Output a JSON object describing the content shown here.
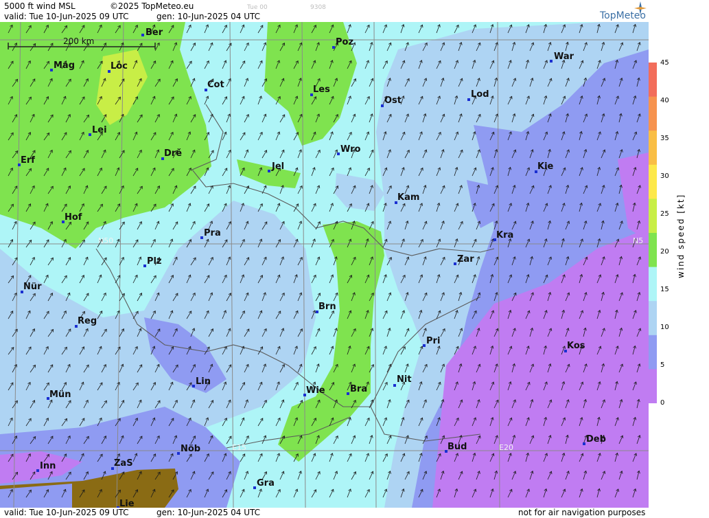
{
  "header": {
    "title": "5000 ft wind MSL",
    "copyright": "©2025 TopMeteo.eu",
    "valid": "valid:  Tue  10-Jun-2025  09 UTC",
    "gen": "gen: 10-Jun-2025 04 UTC",
    "faint_day": "Tue 00",
    "faint_code": "9308",
    "logo_text": "TopMeteo"
  },
  "footer": {
    "valid": "valid:  Tue  10-Jun-2025  09 UTC",
    "gen": "gen: 10-Jun-2025 04 UTC",
    "disclaimer": "not for air navigation purposes"
  },
  "map": {
    "scale_label": "200 km",
    "grid_labels": [
      "N50",
      "N5",
      "E15",
      "E20"
    ],
    "cities": [
      {
        "name": "Ber"
      },
      {
        "name": "Poz"
      },
      {
        "name": "War"
      },
      {
        "name": "Mag"
      },
      {
        "name": "Loc"
      },
      {
        "name": "Cot"
      },
      {
        "name": "Les"
      },
      {
        "name": "Ost"
      },
      {
        "name": "Lod"
      },
      {
        "name": "Lei"
      },
      {
        "name": "Erf"
      },
      {
        "name": "Drě"
      },
      {
        "name": "Jel"
      },
      {
        "name": "Wro"
      },
      {
        "name": "Kie"
      },
      {
        "name": "Kam"
      },
      {
        "name": "Hof"
      },
      {
        "name": "Pra"
      },
      {
        "name": "Kra"
      },
      {
        "name": "Zar"
      },
      {
        "name": "Plz"
      },
      {
        "name": "Nür"
      },
      {
        "name": "Brn"
      },
      {
        "name": "Reg"
      },
      {
        "name": "Pri"
      },
      {
        "name": "Kos"
      },
      {
        "name": "Lin"
      },
      {
        "name": "Nit"
      },
      {
        "name": "Mün"
      },
      {
        "name": "Wie"
      },
      {
        "name": "Bra"
      },
      {
        "name": "Deb"
      },
      {
        "name": "Nöb"
      },
      {
        "name": "Bud"
      },
      {
        "name": "Inn"
      },
      {
        "name": "ZaS"
      },
      {
        "name": "Gra"
      },
      {
        "name": "Lie"
      }
    ]
  },
  "legend": {
    "title": "wind  speed  [kt]",
    "ticks": [
      "45",
      "40",
      "35",
      "30",
      "25",
      "20",
      "15",
      "10",
      "5",
      "0"
    ],
    "colors": [
      "#f26d5b",
      "#f6934f",
      "#f9be45",
      "#fde84a",
      "#c8ee46",
      "#7fe34f",
      "#aef5f7",
      "#aed4f3",
      "#8f9bf2",
      "#c07cf2"
    ]
  }
}
